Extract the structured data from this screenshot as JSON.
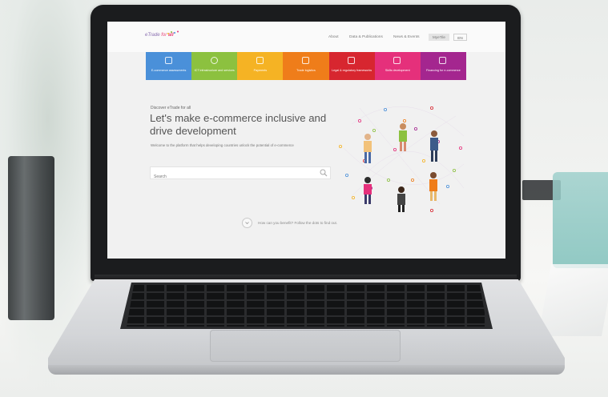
{
  "site": {
    "logo_prefix": "eTrade",
    "logo_for": "for",
    "logo_all": "all"
  },
  "nav": {
    "items": [
      "About",
      "Data & Publications",
      "News & Events"
    ],
    "mytile": "MyeTile",
    "language": "EN"
  },
  "tiles": [
    {
      "label": "E-commerce assessments",
      "color": "#4a90d9",
      "icon": "clipboard-icon"
    },
    {
      "label": "ICT infrastructure and services",
      "color": "#8cc13f",
      "icon": "cloud-icon"
    },
    {
      "label": "Payments",
      "color": "#f5b324",
      "icon": "card-icon"
    },
    {
      "label": "Trade logistics",
      "color": "#ef7d1a",
      "icon": "cart-icon"
    },
    {
      "label": "Legal & regulatory frameworks",
      "color": "#d7262f",
      "icon": "scales-icon"
    },
    {
      "label": "Skills development",
      "color": "#e5307b",
      "icon": "graduation-cap-icon"
    },
    {
      "label": "Financing for e-commerce",
      "color": "#a4268f",
      "icon": "coins-icon"
    }
  ],
  "hero": {
    "kicker": "Discover eTrade for all",
    "headline": "Let's make e-commerce inclusive and drive development",
    "subtitle": "Welcome to the platform that helps developing countries unlock the potential of e-commerce",
    "search_placeholder": "Search",
    "benefit_text": "How can you benefit? Follow the dots to find out."
  }
}
